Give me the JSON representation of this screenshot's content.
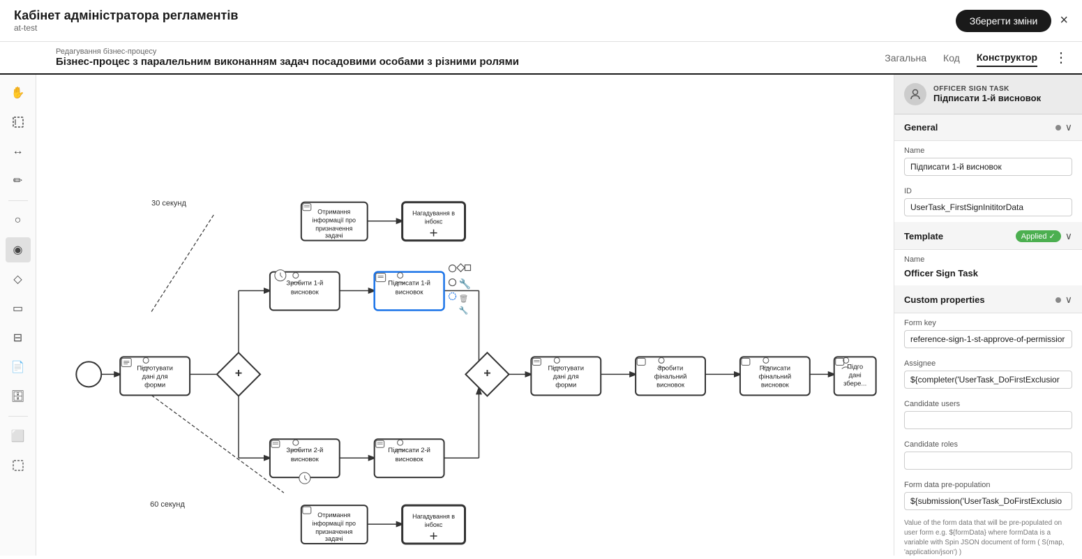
{
  "header": {
    "title": "Кабінет адміністратора регламентів",
    "subtitle": "at-test",
    "save_label": "Зберегти зміни",
    "close_icon": "×"
  },
  "sub_header": {
    "breadcrumb": "Редагування бізнес-процесу",
    "process_title": "Бізнес-процес з паралельним виконанням задач посадовими особами з різними ролями",
    "tabs": [
      {
        "label": "Загальна",
        "active": false
      },
      {
        "label": "Код",
        "active": false
      },
      {
        "label": "Конструктор",
        "active": true
      }
    ]
  },
  "toolbar": {
    "tools": [
      "✋",
      "✛",
      "↔",
      "✏",
      "○",
      "◉",
      "◇",
      "▭",
      "⊟",
      "▭",
      "⊙",
      "▭"
    ]
  },
  "right_panel": {
    "task_type": "OFFICER SIGN TASK",
    "task_name": "Підписати 1-й висновок",
    "sections": {
      "general": {
        "label": "General",
        "name_label": "Name",
        "name_value": "Підписати 1-й висновок",
        "id_label": "ID",
        "id_value": "UserTask_FirstSignInititorData"
      },
      "template": {
        "label": "Template",
        "badge": "Applied ✓",
        "name_label": "Name",
        "name_value": "Officer Sign Task"
      },
      "custom_properties": {
        "label": "Custom properties",
        "form_key_label": "Form key",
        "form_key_value": "reference-sign-1-st-approve-of-permissior",
        "assignee_label": "Assignee",
        "assignee_value": "${completer('UserTask_DoFirstExclusior",
        "candidate_users_label": "Candidate users",
        "candidate_users_value": "",
        "candidate_roles_label": "Candidate roles",
        "candidate_roles_value": "",
        "form_data_label": "Form data pre-population",
        "form_data_value": "${submission('UserTask_DoFirstExclusio",
        "hint": "Value of the form data that will be pre-populated on user form\ne.g. ${formData} where formData is a variable with Spin JSON document of form (\nS(map, 'application/json') )"
      }
    }
  },
  "canvas": {
    "timer_labels": [
      "30 секунд",
      "60 секунд"
    ],
    "nodes": [
      {
        "id": "start",
        "label": ""
      },
      {
        "id": "prepare1",
        "label": "Підготувати дані для форми"
      },
      {
        "id": "gateway1",
        "label": "+"
      },
      {
        "id": "make1",
        "label": "Зробити 1-й висновок"
      },
      {
        "id": "sign1",
        "label": "Підписати 1-й висновок"
      },
      {
        "id": "get-info1",
        "label": "Отримання інформації про призначення задачі"
      },
      {
        "id": "remind1",
        "label": "Нагадування в інбокс"
      },
      {
        "id": "make2",
        "label": "Зробити 2-й висновок"
      },
      {
        "id": "sign2",
        "label": "Підписати 2-й висновок"
      },
      {
        "id": "get-info2",
        "label": "Отримання інформації про призначення задачі"
      },
      {
        "id": "remind2",
        "label": "Нагадування в інбокс"
      },
      {
        "id": "gateway2",
        "label": "+"
      },
      {
        "id": "prepare2",
        "label": "Підготувати дані для форми"
      },
      {
        "id": "make-final",
        "label": "Зробити фінальний висновок"
      },
      {
        "id": "sign-final",
        "label": "Підписати фінальний висновок"
      },
      {
        "id": "prepare-save",
        "label": "Підго дані збере"
      }
    ]
  }
}
